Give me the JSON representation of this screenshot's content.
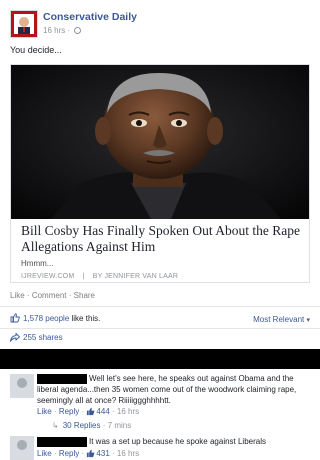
{
  "post": {
    "page_name": "Conservative Daily",
    "time": "16 hrs",
    "separator": "·",
    "text": "You decide..."
  },
  "link": {
    "title": "Bill Cosby Has Finally Spoken Out About the Rape Allegations Against Him",
    "description": "Hmmm...",
    "source": "IJREVIEW.COM",
    "source_sep": "|",
    "author": "BY JENNIFER VAN LAAR"
  },
  "actions": {
    "like": "Like",
    "comment": "Comment",
    "share": "Share",
    "sep": "·"
  },
  "likes": {
    "count": "1,578 people",
    "suffix": "like this.",
    "sort_label": "Most Relevant",
    "sort_caret": "▾",
    "shares": "255 shares"
  },
  "comments": [
    {
      "text_line1": "Well let's see here, he speaks out against Obama and the",
      "text_rest": "liberal agenda...then 35 women come out of the woodwork claiming rape, seemingly all at once? Riiiiiggghhhhtt.",
      "like": "Like",
      "reply": "Reply",
      "sep": "·",
      "like_count": "444",
      "time": "16 hrs",
      "replies_label": "30 Replies",
      "replies_time": "7 mins"
    },
    {
      "text": "It was a set up because he spoke against Liberals",
      "like": "Like",
      "reply": "Reply",
      "sep": "·",
      "like_count": "431",
      "time": "16 hrs"
    }
  ],
  "colors": {
    "link_blue": "#3b5998",
    "muted_gray": "#90949c",
    "avatar_red": "#b3141c",
    "redaction": "#000000"
  },
  "icons": [
    "page-avatar-icon",
    "globe-icon",
    "thumbs-up-icon",
    "share-icon",
    "reply-arrow-icon"
  ]
}
